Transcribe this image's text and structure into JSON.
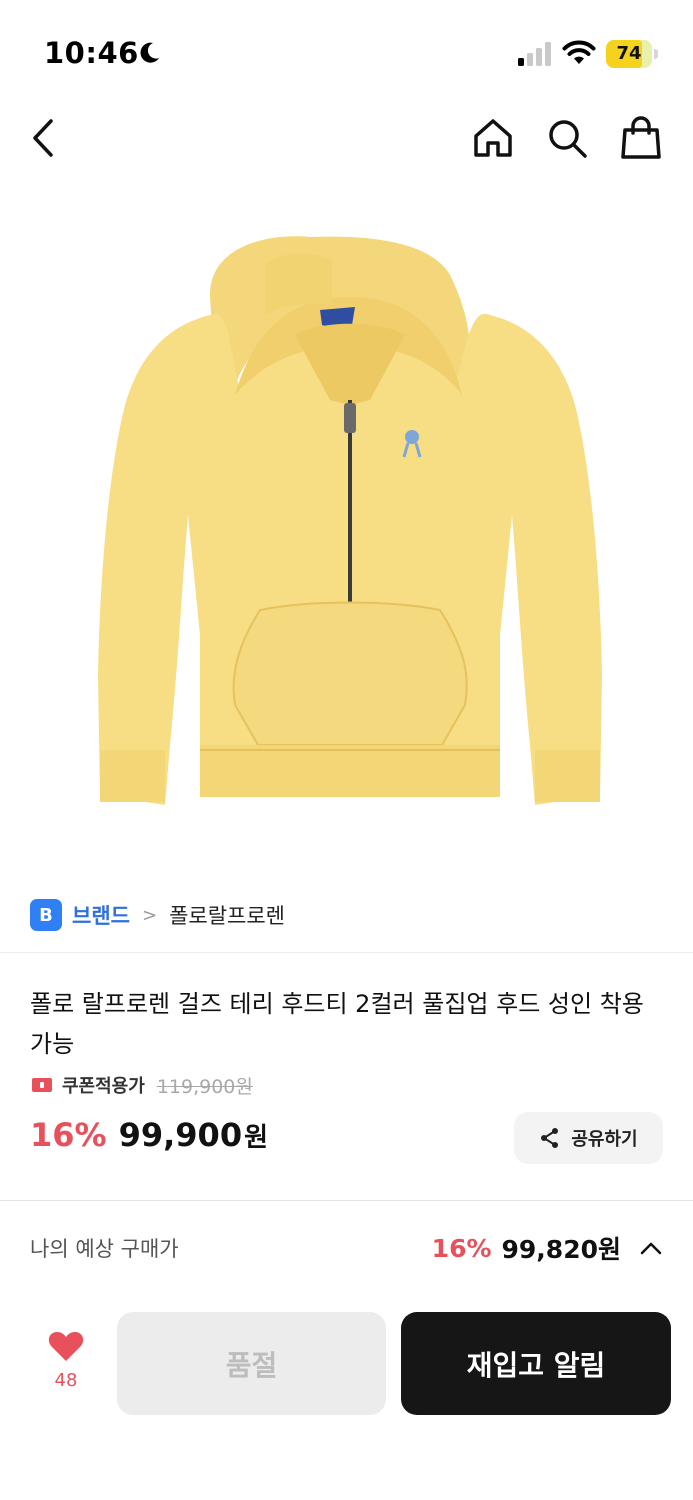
{
  "status_bar": {
    "time": "10:46",
    "battery_level": "74"
  },
  "nav": {
    "icons": [
      "back-arrow-icon",
      "home-icon",
      "search-icon",
      "shopping-bag-icon"
    ]
  },
  "brand": {
    "badge": "B",
    "label": "브랜드",
    "separator": ">",
    "name": "폴로랄프로렌"
  },
  "product": {
    "title": "폴로 랄프로렌 걸즈 테리 후드티 2컬러 풀집업 후드 성인 착용 가능",
    "coupon_label": "쿠폰적용가",
    "original_price": "119,900원",
    "discount_rate": "16%",
    "price": "99,900",
    "currency": "원",
    "share_label": "공유하기"
  },
  "expected": {
    "label": "나의 예상 구매가",
    "discount_rate": "16%",
    "price": "99,820원"
  },
  "bottom_bar": {
    "like_count": "48",
    "soldout_label": "품절",
    "restock_label": "재입고 알림"
  },
  "colors": {
    "accent_red": "#e8505b",
    "brand_blue": "#2f7ff5",
    "hoodie_yellow": "#f7dd84",
    "battery_yellow": "#f5d21b"
  }
}
